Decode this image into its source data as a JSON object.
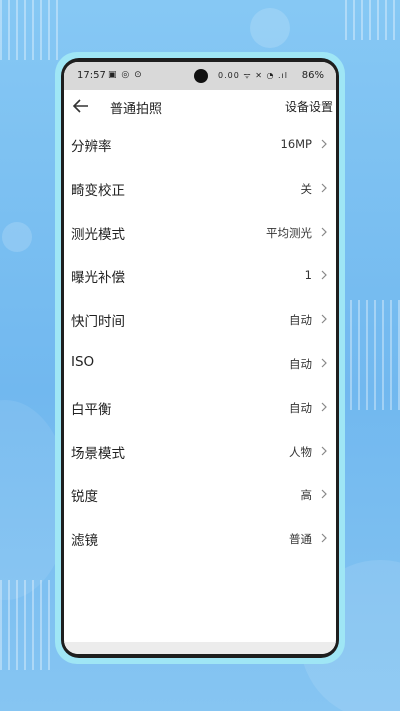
{
  "status_bar": {
    "time": "17:57",
    "left_icons": "▣ ◎ ⊙",
    "right_icons": "0.00 ᯤ ✕ ◔ .ıl",
    "battery": "86%"
  },
  "header": {
    "back_icon": "arrow-left-icon",
    "title": "普通拍照",
    "action": "设备设置"
  },
  "settings": [
    {
      "label": "分辨率",
      "value": "16MP"
    },
    {
      "label": "畸变校正",
      "value": "关"
    },
    {
      "label": "测光模式",
      "value": "平均测光"
    },
    {
      "label": "曝光补偿",
      "value": "1"
    },
    {
      "label": "快门时间",
      "value": "自动"
    },
    {
      "label": "ISO",
      "value": "自动"
    },
    {
      "label": "白平衡",
      "value": "自动"
    },
    {
      "label": "场景模式",
      "value": "人物"
    },
    {
      "label": "锐度",
      "value": "高"
    },
    {
      "label": "滤镜",
      "value": "普通"
    }
  ],
  "colors": {
    "background_blue": "#7dc1f1",
    "phone_border_glow": "#9fe6f5",
    "status_bar_gray": "#d9d9d9"
  }
}
